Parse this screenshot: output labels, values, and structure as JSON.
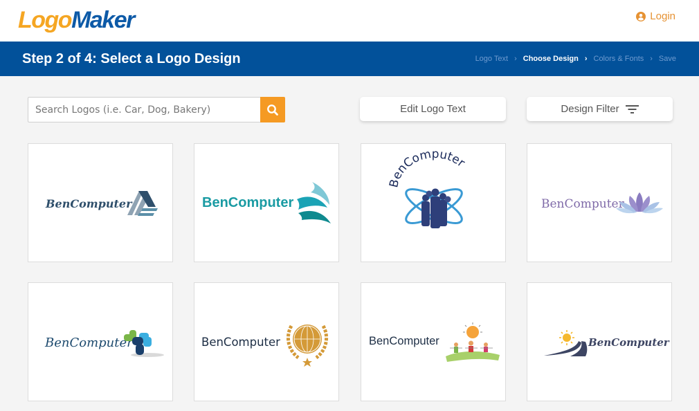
{
  "header": {
    "logo_part1": "Logo",
    "logo_part2": "Maker",
    "login_label": "Login",
    "login_icon": "user-circle-icon"
  },
  "stepbar": {
    "title": "Step 2 of 4: Select a Logo Design",
    "breadcrumbs": [
      {
        "label": "Logo Text",
        "active": false
      },
      {
        "label": "Choose Design",
        "active": true
      },
      {
        "label": "Colors & Fonts",
        "active": false
      },
      {
        "label": "Save",
        "active": false
      }
    ],
    "separator": "›"
  },
  "toolbar": {
    "search_placeholder": "Search Logos (i.e. Car, Dog, Bakery)",
    "search_value": "",
    "search_icon": "search-icon",
    "edit_text_label": "Edit Logo Text",
    "filter_label": "Design Filter",
    "filter_icon": "filter-lines-icon"
  },
  "colors": {
    "brand_orange": "#f5a623",
    "brand_blue": "#0d5aa7",
    "stepbar_bg": "#02519a",
    "search_button": "#f59a23",
    "login": "#e69233"
  },
  "logos": [
    {
      "text": "BenComputer",
      "style": "script-navy",
      "icon": "roof-stripes-icon"
    },
    {
      "text": "BenComputer",
      "style": "bold-teal",
      "icon": "teal-waves-icon"
    },
    {
      "text": "BenComputer",
      "style": "arched-navy",
      "icon": "business-team-orbit-icon"
    },
    {
      "text": "BenComputer",
      "style": "serif-purple",
      "icon": "lotus-icon"
    },
    {
      "text": "BenComputer",
      "style": "script-navy",
      "icon": "puzzle-cross-icon"
    },
    {
      "text": "BenComputer",
      "style": "sans-dark",
      "icon": "globe-laurel-icon"
    },
    {
      "text": "BenComputer",
      "style": "sans-dark",
      "icon": "kids-sun-icon"
    },
    {
      "text": "BenComputer",
      "style": "script-slate",
      "icon": "sun-road-icon"
    }
  ]
}
